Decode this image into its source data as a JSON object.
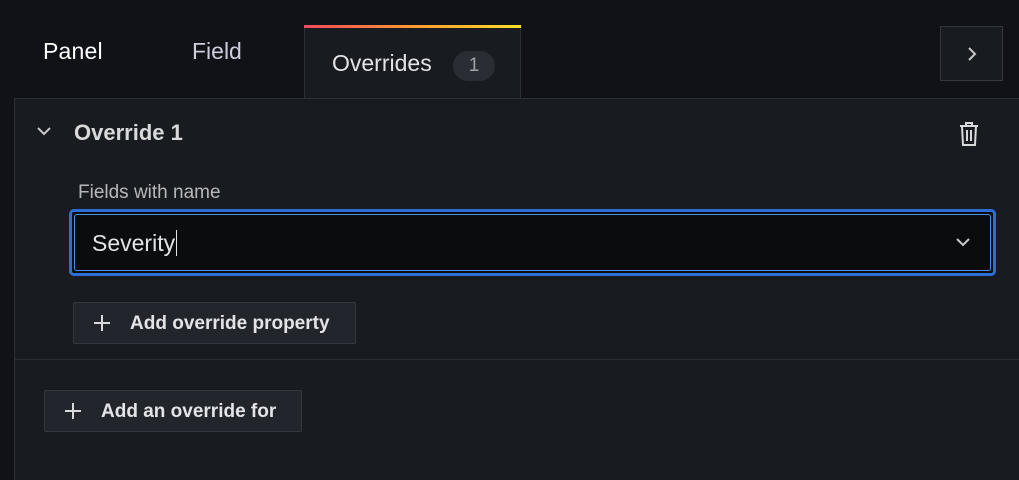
{
  "tabs": {
    "panel_label": "Panel",
    "field_label": "Field",
    "overrides_label": "Overrides",
    "overrides_count": "1"
  },
  "override": {
    "title": "Override 1",
    "matcher_label": "Fields with name",
    "matcher_value": "Severity",
    "add_property_label": "Add override property"
  },
  "footer": {
    "add_override_label": "Add an override for"
  },
  "icons": {
    "collapse_pane": "chevron-right-icon",
    "override_toggle": "chevron-down-icon",
    "delete": "trash-icon",
    "select_dropdown": "chevron-down-icon",
    "add": "plus-icon"
  },
  "colors": {
    "tab_accent_gradient": [
      "#f2495c",
      "#ff9830",
      "#fade2a"
    ],
    "focus_border": "#2d6ed6",
    "background": "#111217",
    "panel_bg": "#181b1f"
  }
}
